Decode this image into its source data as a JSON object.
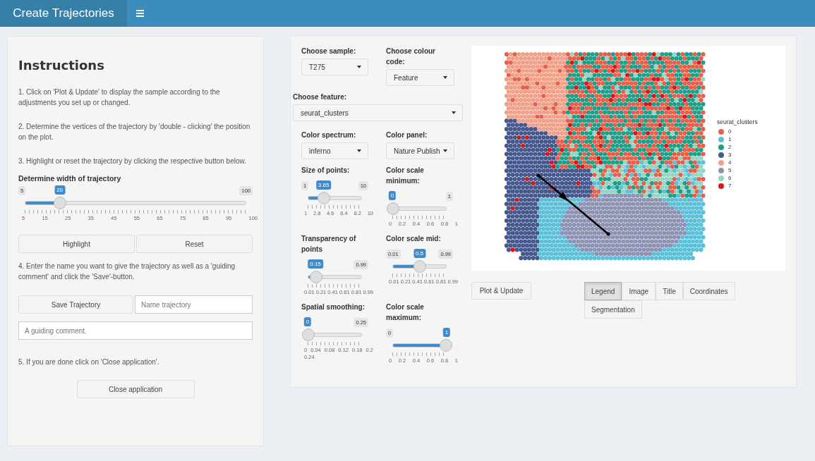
{
  "header": {
    "title": "Create Trajectories"
  },
  "instructions": {
    "title": "Instructions",
    "steps": [
      "1. Click on 'Plot & Update' to display the sample according to the adjustments you set up or changed.",
      "2. Determine the vertices of the trajectory by 'double - clicking' the position on the plot.",
      "3. Highlight or reset the trajectory by clicking the respective button below."
    ],
    "width_slider": {
      "label": "Determine width of trajectory",
      "min": "5",
      "max": "100",
      "value": "20",
      "level": 0.158,
      "grid": "5 15 25 35 45 55 65 75 85 95 100"
    },
    "highlight_buttons": [
      "Highlight",
      "Reset"
    ],
    "step4": "4. Enter the name you want to give the trajectory as well as a 'guiding comment' and click the 'Save'-button.",
    "save_button": "Save Trajectory",
    "name_field": {
      "placeholder": "Name trajectory"
    },
    "comment_field": {
      "placeholder": "A guiding comment."
    },
    "step5": "5. If you are done click on 'Close application'.",
    "close_button": "Close application"
  },
  "controls": {
    "top_row": [
      {
        "kind": "select",
        "label": "Choose sample:",
        "value": "T275"
      },
      {
        "kind": "select",
        "label": "Choose colour code:",
        "value": "Feature"
      }
    ],
    "feature": {
      "label": "Choose feature:",
      "value": "seurat_clusters"
    },
    "rows": [
      [
        {
          "kind": "select",
          "label": "Color spectrum:",
          "value": "inferno"
        },
        {
          "kind": "select",
          "label": "Color panel:",
          "value": "Nature Publish"
        }
      ],
      [
        {
          "kind": "slider",
          "label": "Size of points:",
          "min": "1",
          "max": "10",
          "value": "3.65",
          "level": 0.294,
          "grid": "1 2.8 4.6 6.4 8.2 10"
        },
        {
          "kind": "slider",
          "label": "Color scale minimum:",
          "max": "1",
          "value": "0",
          "level": 0,
          "grid": "0 0.2 0.4 0.6 0.8 1"
        }
      ],
      [
        {
          "kind": "slider",
          "label": "Transparency of points",
          "max": "0.99",
          "value": "0.15",
          "level": 0.143,
          "grid": "0.01 0.21 0.41 0.61 0.81 0.99"
        },
        {
          "kind": "slider",
          "label": "Color scale mid:",
          "min": "0.01",
          "max": "0.99",
          "value": "0.5",
          "level": 0.5,
          "grid": "0.01 0.21 0.41 0.61 0.81 0.99"
        }
      ],
      [
        {
          "kind": "slider",
          "label": "Spatial smoothing:",
          "max": "0.25",
          "value": "0",
          "level": 0,
          "grid": "0 0.04 0.08 0.12 0.16 0.2 0.24"
        },
        {
          "kind": "slider",
          "label": "Color scale maximum:",
          "min": "0",
          "value": "1",
          "level": 1,
          "grid": "0 0.2 0.4 0.6 0.8 1"
        }
      ]
    ]
  },
  "plot": {
    "legend": {
      "title": "seurat_clusters",
      "items": [
        {
          "label": "0",
          "color": "#e6604c"
        },
        {
          "label": "1",
          "color": "#5bc0d8"
        },
        {
          "label": "2",
          "color": "#1f9e89"
        },
        {
          "label": "3",
          "color": "#45598f"
        },
        {
          "label": "4",
          "color": "#f1a08a"
        },
        {
          "label": "5",
          "color": "#8e93b3"
        },
        {
          "label": "6",
          "color": "#95d5c3"
        },
        {
          "label": "7",
          "color": "#d7191c"
        }
      ]
    }
  },
  "plot_button": "Plot & Update",
  "view_toggles": [
    {
      "label": "Legend",
      "selected": true
    },
    {
      "label": "Image",
      "selected": false
    },
    {
      "label": "Title",
      "selected": false
    },
    {
      "label": "Coordinates",
      "selected": false
    },
    {
      "label": "Segmentation",
      "selected": false
    }
  ]
}
